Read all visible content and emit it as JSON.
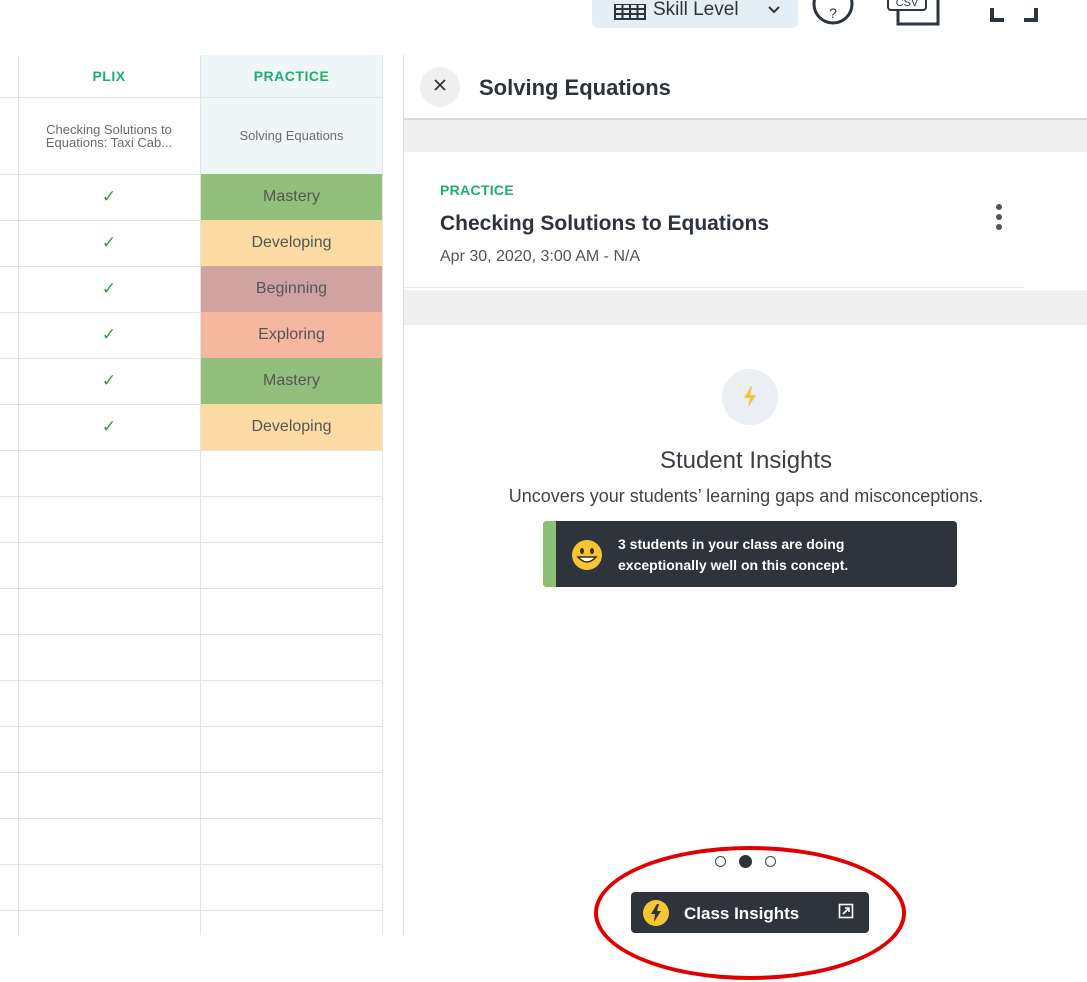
{
  "toolbar": {
    "skill_level_label": "Skill Level",
    "icons": [
      "grid-icon",
      "chevron-down-icon",
      "help-icon",
      "csv-icon",
      "fullscreen-icon"
    ],
    "csv_label": "CSV"
  },
  "grid": {
    "columns": [
      {
        "header": "PLIX",
        "subheader": "Checking Solutions to Equations: Taxi Cab..."
      },
      {
        "header": "PRACTICE",
        "subheader": "Solving Equations"
      }
    ],
    "rows": [
      {
        "plix": "✓",
        "practice": "Mastery",
        "color": "#93bf7c"
      },
      {
        "plix": "✓",
        "practice": "Developing",
        "color": "#fcdba5"
      },
      {
        "plix": "✓",
        "practice": "Beginning",
        "color": "#cfa3a1"
      },
      {
        "plix": "✓",
        "practice": "Exploring",
        "color": "#f6b7a1"
      },
      {
        "plix": "✓",
        "practice": "Mastery",
        "color": "#93bf7c"
      },
      {
        "plix": "✓",
        "practice": "Developing",
        "color": "#fcdba5"
      }
    ],
    "empty_rows": 11,
    "accent_color": "#1fae6f"
  },
  "panel": {
    "title": "Solving Equations",
    "card": {
      "tag": "PRACTICE",
      "title": "Checking Solutions to Equations",
      "date": "Apr 30, 2020, 3:00 AM - N/A"
    },
    "insights": {
      "title": "Student Insights",
      "subtitle": "Uncovers your students’ learning gaps and misconceptions.",
      "banner_line1": "3 students in your class are doing",
      "banner_line2": "exceptionally well on this concept."
    },
    "carousel": {
      "count": 3,
      "active": 2
    },
    "class_insights_label": "Class Insights"
  }
}
